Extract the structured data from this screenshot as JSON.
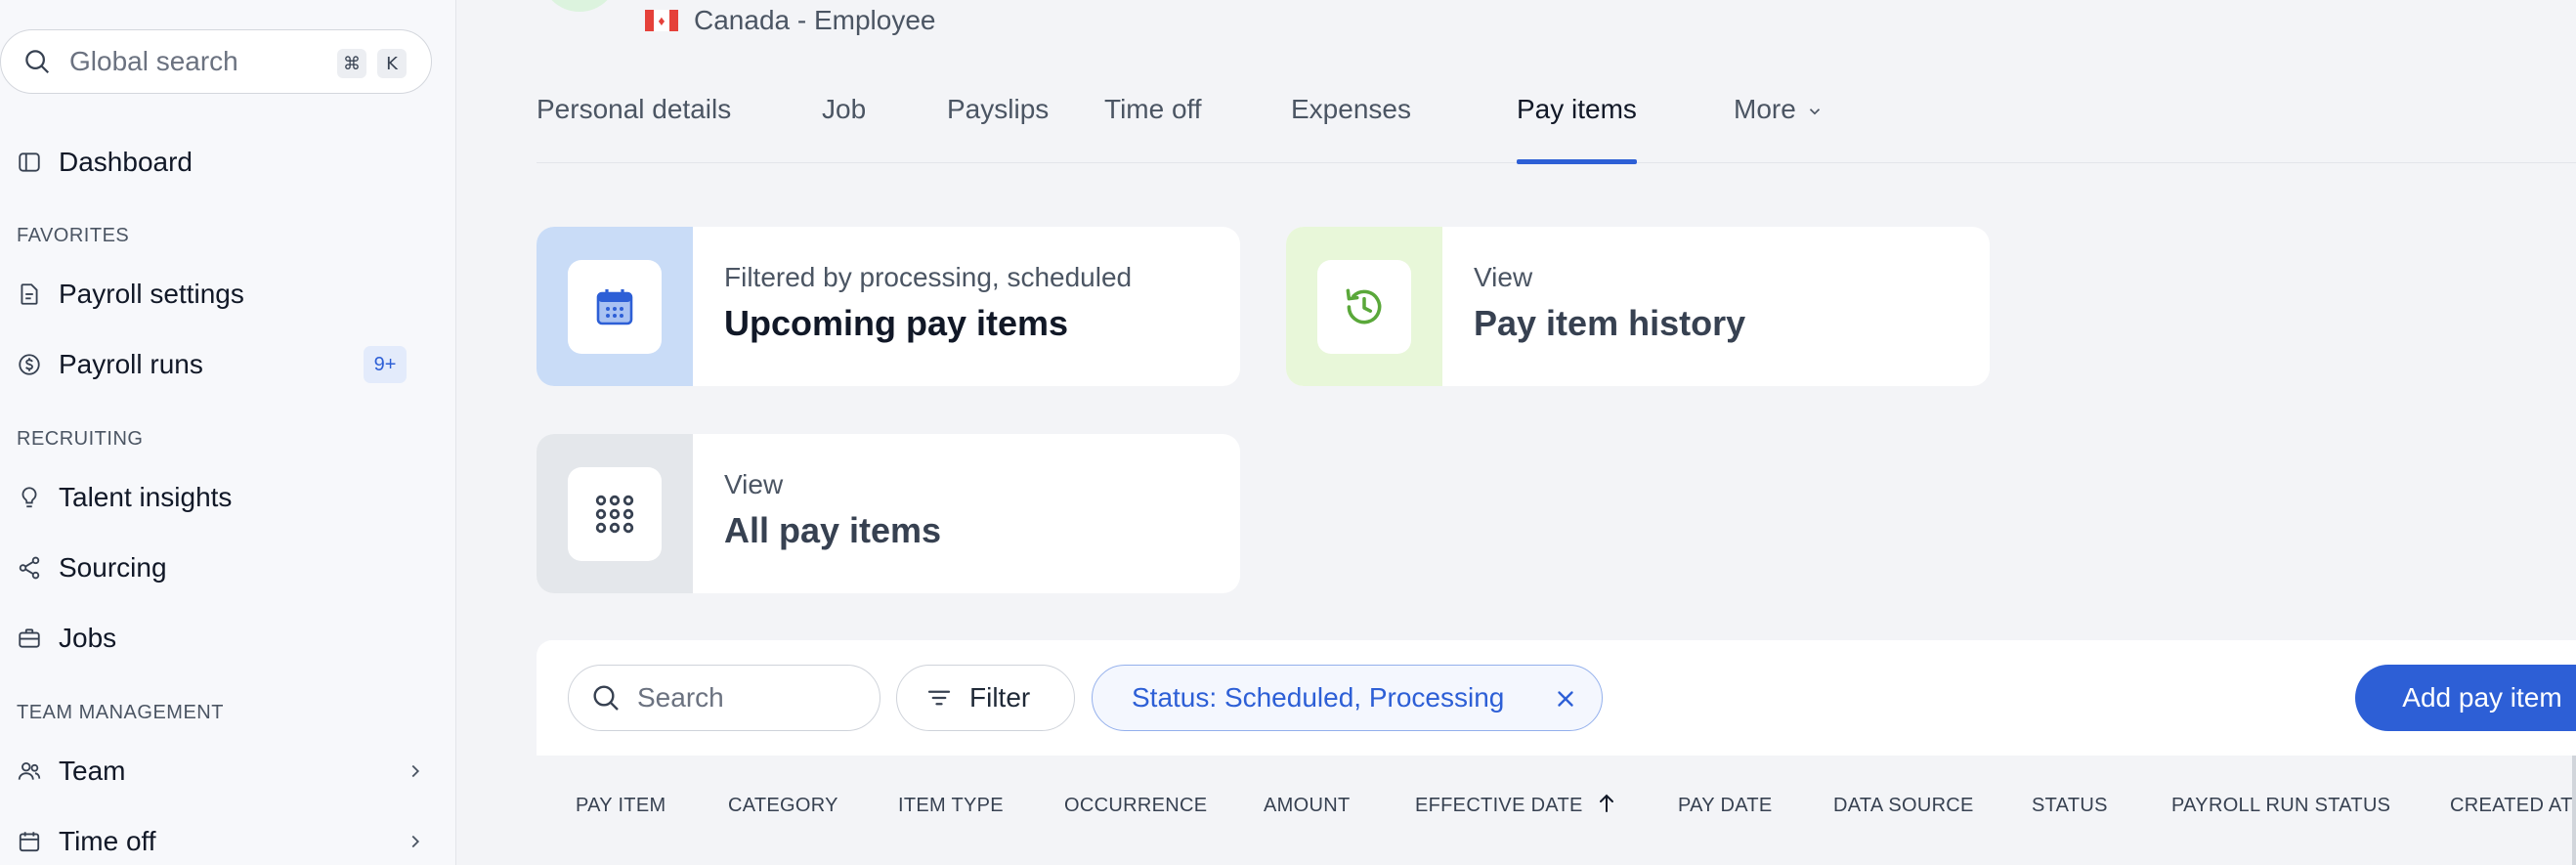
{
  "sidebar": {
    "search": {
      "placeholder": "Global search",
      "shortcut_mod": "⌘",
      "shortcut_key": "K"
    },
    "dashboard": "Dashboard",
    "sections": {
      "favorites": "FAVORITES",
      "recruiting": "RECRUITING",
      "team_management": "TEAM MANAGEMENT"
    },
    "items": {
      "payroll_settings": "Payroll settings",
      "payroll_runs": "Payroll runs",
      "payroll_runs_badge": "9+",
      "talent_insights": "Talent insights",
      "sourcing": "Sourcing",
      "jobs": "Jobs",
      "team": "Team",
      "time_off": "Time off"
    }
  },
  "header": {
    "employee_type": "Canada - Employee"
  },
  "tabs": {
    "personal_details": "Personal details",
    "job": "Job",
    "payslips": "Payslips",
    "time_off": "Time off",
    "expenses": "Expenses",
    "pay_items": "Pay items",
    "more": "More",
    "active": "Pay items"
  },
  "cards": {
    "upcoming": {
      "sub": "Filtered by processing, scheduled",
      "title": "Upcoming pay items"
    },
    "history": {
      "sub": "View",
      "title": "Pay item history"
    },
    "all": {
      "sub": "View",
      "title": "All pay items"
    }
  },
  "toolbar": {
    "search_placeholder": "Search",
    "filter_label": "Filter",
    "status_chip": "Status: Scheduled, Processing",
    "add_button": "Add pay item"
  },
  "table": {
    "columns": [
      "PAY ITEM",
      "CATEGORY",
      "ITEM TYPE",
      "OCCURRENCE",
      "AMOUNT",
      "EFFECTIVE DATE",
      "PAY DATE",
      "DATA SOURCE",
      "STATUS",
      "PAYROLL RUN STATUS",
      "CREATED AT"
    ],
    "sorted_column": "EFFECTIVE DATE",
    "sort_direction": "ascending"
  },
  "colors": {
    "accent": "#2d5fd6",
    "badge_bg": "#e3ebfb",
    "upcoming_side": "#c9dcf7",
    "history_side": "#e8f7d9",
    "all_side": "#e4e7eb"
  }
}
